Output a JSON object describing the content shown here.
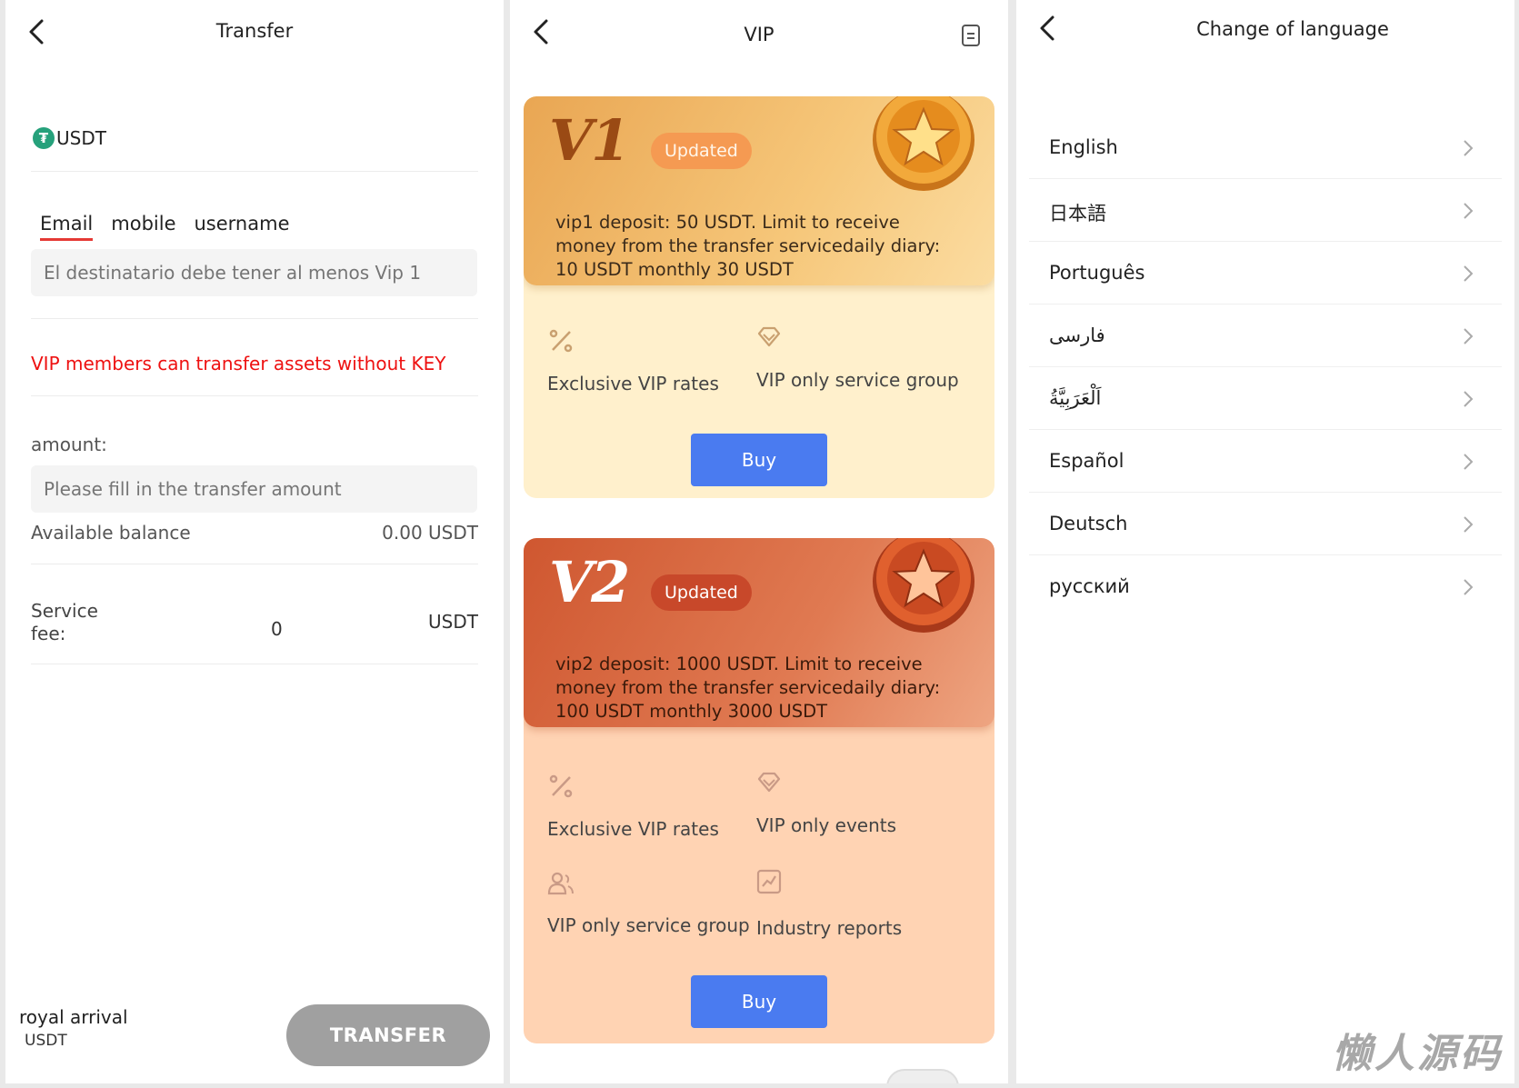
{
  "transfer": {
    "title": "Transfer",
    "coin": "USDT",
    "coin_icon_glyph": "₮",
    "tabs": [
      "Email",
      "mobile",
      "username"
    ],
    "recipient_placeholder": "El destinatario debe tener al menos Vip 1",
    "vip_note": "VIP members can transfer assets without KEY",
    "amount_label": "amount:",
    "amount_placeholder": "Please fill in the transfer amount",
    "available_label": "Available balance",
    "available_value": "0.00 USDT",
    "fee_label_1": "Service",
    "fee_label_2": "fee:",
    "fee_value": "0",
    "fee_unit": "USDT",
    "footer_name": "royal arrival",
    "footer_unit": "USDT",
    "button": "TRANSFER"
  },
  "vip": {
    "title": "VIP",
    "cards": [
      {
        "level": "V1",
        "badge": "Updated",
        "desc": "vip1 deposit:  50 USDT. Limit to receive money from the transfer servicedaily diary:  10 USDT monthly 30 USDT",
        "features": [
          "Exclusive VIP rates",
          "VIP only service group"
        ],
        "buy": "Buy"
      },
      {
        "level": "V2",
        "badge": "Updated",
        "desc": "vip2 deposit:  1000 USDT. Limit to receive money from the transfer servicedaily diary:  100 USDT monthly 3000 USDT",
        "features": [
          "Exclusive VIP rates",
          "VIP only events",
          "VIP only service group",
          "Industry reports"
        ],
        "buy": "Buy"
      }
    ],
    "colors": {
      "v1_head": "#f0b463",
      "v1_body": "#fff0cc",
      "v2_head": "#d9633c",
      "v2_body": "#ffd3b3",
      "buy": "#4a7bf0"
    }
  },
  "language": {
    "title": "Change of language",
    "items": [
      "English",
      "日本語",
      "Português",
      "فارسی",
      "اَلْعَرَبِيَّةُ",
      "Español",
      "Deutsch",
      "русский"
    ]
  },
  "watermark": "懒人源码"
}
